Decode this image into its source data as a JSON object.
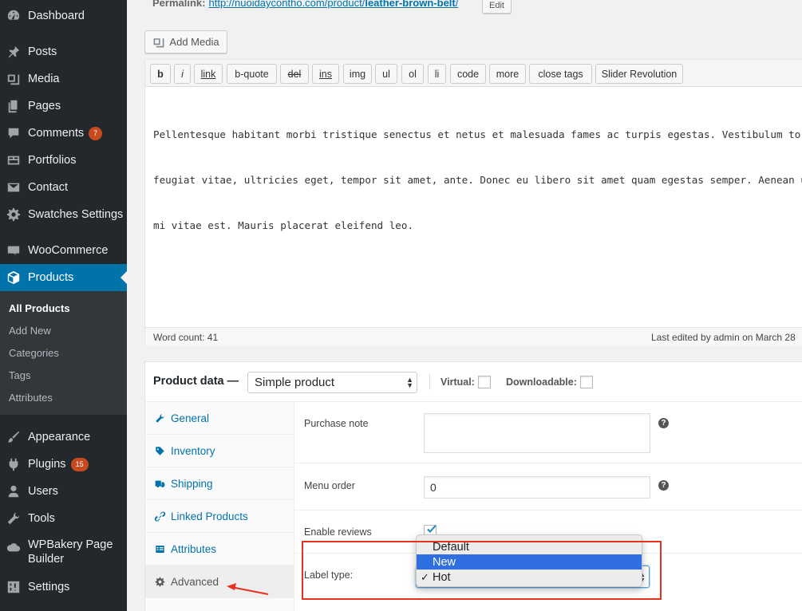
{
  "sidebar": {
    "items": [
      {
        "label": "Dashboard",
        "icon": "dashboard-icon"
      },
      {
        "label": "Posts",
        "icon": "pin-icon"
      },
      {
        "label": "Media",
        "icon": "media-icon"
      },
      {
        "label": "Pages",
        "icon": "pages-icon"
      },
      {
        "label": "Comments",
        "icon": "comments-icon",
        "badge": "7"
      },
      {
        "label": "Portfolios",
        "icon": "portfolio-icon"
      },
      {
        "label": "Contact",
        "icon": "mail-icon"
      },
      {
        "label": "Swatches Settings",
        "icon": "gear-icon"
      },
      {
        "label": "WooCommerce",
        "icon": "woocommerce-icon"
      },
      {
        "label": "Products",
        "icon": "box-icon"
      },
      {
        "label": "Appearance",
        "icon": "brush-icon"
      },
      {
        "label": "Plugins",
        "icon": "plug-icon",
        "badge": "15"
      },
      {
        "label": "Users",
        "icon": "user-icon"
      },
      {
        "label": "Tools",
        "icon": "wrench-icon"
      },
      {
        "label": "WPBakery Page",
        "label2": "Builder",
        "icon": "cloud-icon"
      },
      {
        "label": "Settings",
        "icon": "settings-sliders-icon"
      }
    ],
    "submenu": [
      "All Products",
      "Add New",
      "Categories",
      "Tags",
      "Attributes"
    ]
  },
  "permalink": {
    "label": "Permalink:",
    "base": "http://nuoidaycontho.com/product/",
    "slug": "leather-brown-belt",
    "trail": "/",
    "edit_label": "Edit"
  },
  "editor": {
    "add_media_label": "Add Media",
    "quicktags": [
      "b",
      "i",
      "link",
      "b-quote",
      "del",
      "ins",
      "img",
      "ul",
      "ol",
      "li",
      "code",
      "more",
      "close tags",
      "Slider Revolution"
    ],
    "lines": [
      "Pellentesque habitant morbi tristique senectus et netus et malesuada fames ac turpis egestas. Vestibulum tortor quam,",
      "feugiat vitae, ultricies eget, tempor sit amet, ante. Donec eu libero sit amet quam egestas semper. Aenean ultricies",
      "mi vitae est. Mauris placerat eleifend leo."
    ],
    "word_count": "Word count: 41",
    "last_edited": "Last edited by admin on March 28"
  },
  "product_data": {
    "title": "Product data —",
    "type_value": "Simple product",
    "virtual_label": "Virtual:",
    "downloadable_label": "Downloadable:",
    "tabs": [
      {
        "label": "General",
        "icon": "wrench-icon"
      },
      {
        "label": "Inventory",
        "icon": "tag-icon"
      },
      {
        "label": "Shipping",
        "icon": "truck-icon"
      },
      {
        "label": "Linked Products",
        "icon": "link-icon"
      },
      {
        "label": "Attributes",
        "icon": "list-icon"
      },
      {
        "label": "Advanced",
        "icon": "gear-icon"
      }
    ],
    "fields": {
      "purchase_note_label": "Purchase note",
      "menu_order_label": "Menu order",
      "menu_order_value": "0",
      "enable_reviews_label": "Enable reviews",
      "label_type_label": "Label type:",
      "help": "?"
    },
    "label_type_options": [
      "Default",
      "New",
      "Hot"
    ],
    "label_type_selected": "Hot",
    "label_type_highlighted": "New"
  },
  "colors": {
    "sidebar_bg": "#23282d",
    "active_blue": "#0073aa",
    "annotation_red": "#e8311f",
    "badge": "#ca4a1f"
  }
}
